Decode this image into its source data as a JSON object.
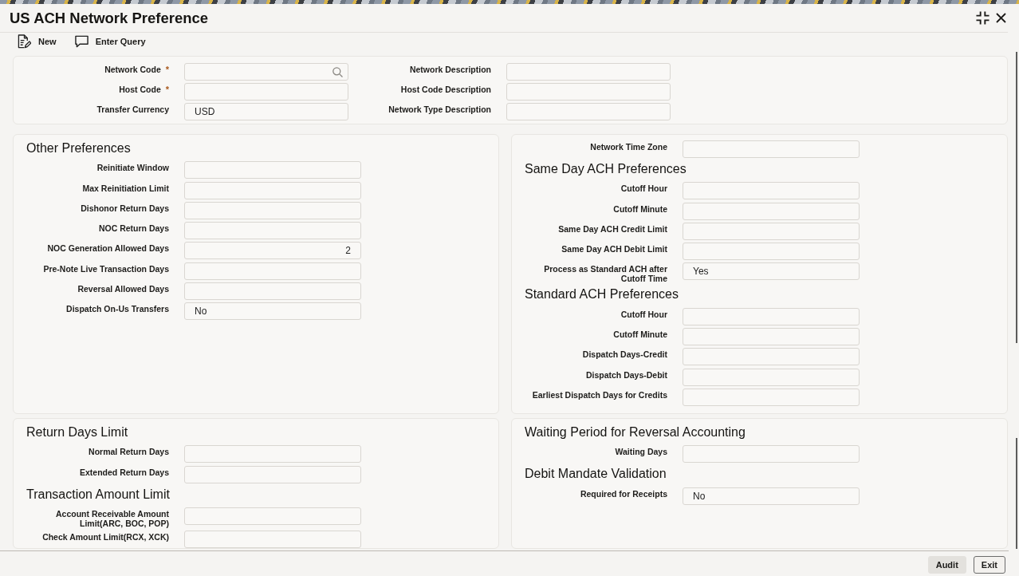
{
  "window": {
    "title": "US ACH Network Preference"
  },
  "toolbar": [
    {
      "label": "New",
      "kind": "new"
    },
    {
      "label": "Enter Query",
      "kind": "query"
    }
  ],
  "header": {
    "required_mark": "*",
    "fields": [
      {
        "label": "Network Code",
        "required": true,
        "kind": "lookup"
      },
      {
        "label": "Network Description",
        "required": false,
        "kind": "text"
      },
      {
        "label": "Host Code",
        "required": true,
        "kind": "text"
      },
      {
        "label": "Host Code Description",
        "required": false,
        "kind": "text"
      },
      {
        "label": "Transfer Currency",
        "required": false,
        "kind": "text",
        "value": "USD"
      },
      {
        "label": "Network Type Description",
        "required": false,
        "kind": "text"
      }
    ]
  },
  "panels": [
    {
      "groups": [
        {
          "title": "Other Preferences",
          "fields": [
            {
              "label": "Reinitiate Window",
              "kind": "text"
            },
            {
              "label": "Max Reinitiation Limit",
              "kind": "text"
            },
            {
              "label": "Dishonor Return Days",
              "kind": "text"
            },
            {
              "label": "NOC Return Days",
              "kind": "text"
            },
            {
              "label": "NOC Generation Allowed Days",
              "kind": "number",
              "value": "2"
            },
            {
              "label": "Pre-Note Live Transaction Days",
              "kind": "text"
            },
            {
              "label": "Reversal Allowed Days",
              "kind": "text"
            },
            {
              "label": "Dispatch On-Us Transfers",
              "kind": "text",
              "value": "No"
            }
          ]
        }
      ]
    },
    {
      "groups": [
        {
          "fields": [
            {
              "label": "Network Time Zone",
              "kind": "text"
            }
          ]
        },
        {
          "title": "Same Day ACH Preferences",
          "fields": [
            {
              "label": "Cutoff Hour",
              "kind": "text"
            },
            {
              "label": "Cutoff Minute",
              "kind": "text"
            },
            {
              "label": "Same Day ACH Credit Limit",
              "kind": "text"
            },
            {
              "label": "Same Day ACH Debit Limit",
              "kind": "text"
            },
            {
              "label": "Process as Standard ACH after Cutoff Time",
              "kind": "text",
              "value": "Yes"
            }
          ]
        },
        {
          "title": "Standard ACH Preferences",
          "fields": [
            {
              "label": "Cutoff Hour",
              "kind": "text"
            },
            {
              "label": "Cutoff Minute",
              "kind": "text"
            },
            {
              "label": "Dispatch Days-Credit",
              "kind": "text"
            },
            {
              "label": "Dispatch Days-Debit",
              "kind": "text"
            },
            {
              "label": "Earliest Dispatch Days for Credits",
              "kind": "text"
            }
          ]
        }
      ]
    },
    {
      "groups": [
        {
          "title": "Return Days Limit",
          "fields": [
            {
              "label": "Normal Return Days",
              "kind": "text"
            },
            {
              "label": "Extended Return Days",
              "kind": "text"
            }
          ]
        },
        {
          "title": "Transaction Amount Limit",
          "fields": [
            {
              "label": "Account Receivable Amount Limit(ARC, BOC, POP)",
              "kind": "text"
            },
            {
              "label": "Check Amount Limit(RCX, XCK)",
              "kind": "text"
            }
          ]
        }
      ]
    },
    {
      "groups": [
        {
          "title": "Waiting Period for Reversal Accounting",
          "fields": [
            {
              "label": "Waiting Days",
              "kind": "text"
            }
          ]
        },
        {
          "title": "Debit Mandate Validation",
          "fields": [
            {
              "label": "Required for Receipts",
              "kind": "text",
              "value": "No"
            }
          ]
        }
      ]
    }
  ],
  "footer": {
    "buttons": [
      {
        "label": "Audit",
        "kind": "filled"
      },
      {
        "label": "Exit",
        "kind": "outlined"
      }
    ]
  }
}
